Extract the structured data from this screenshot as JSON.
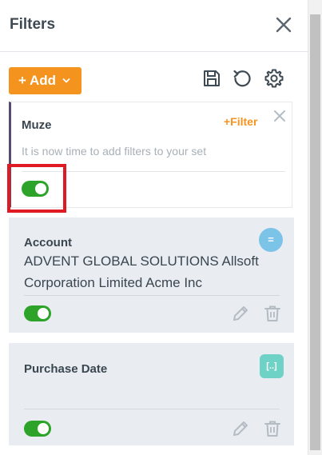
{
  "header": {
    "title": "Filters"
  },
  "toolbar": {
    "add_label": "+ Add"
  },
  "filter_set": {
    "name": "Muze",
    "add_filter_label": "+Filter",
    "hint": "It is now time to add filters to your set",
    "enabled": true
  },
  "filters": [
    {
      "label": "Account",
      "value": "ADVENT GLOBAL SOLUTIONS Allsoft Corporation Limited Acme Inc",
      "badge": "=",
      "badge_color": "#7cc3e8",
      "enabled": true
    },
    {
      "label": "Purchase Date",
      "value": "",
      "badge": "[..]",
      "badge_color": "#6fd2c6",
      "enabled": true
    }
  ],
  "colors": {
    "accent": "#f4931d",
    "toggle_on": "#2ea32a",
    "highlight": "#e01a22"
  },
  "icons": [
    "close-icon",
    "chevron-down-icon",
    "save-icon",
    "reset-icon",
    "gear-icon",
    "edit-icon",
    "trash-icon"
  ]
}
